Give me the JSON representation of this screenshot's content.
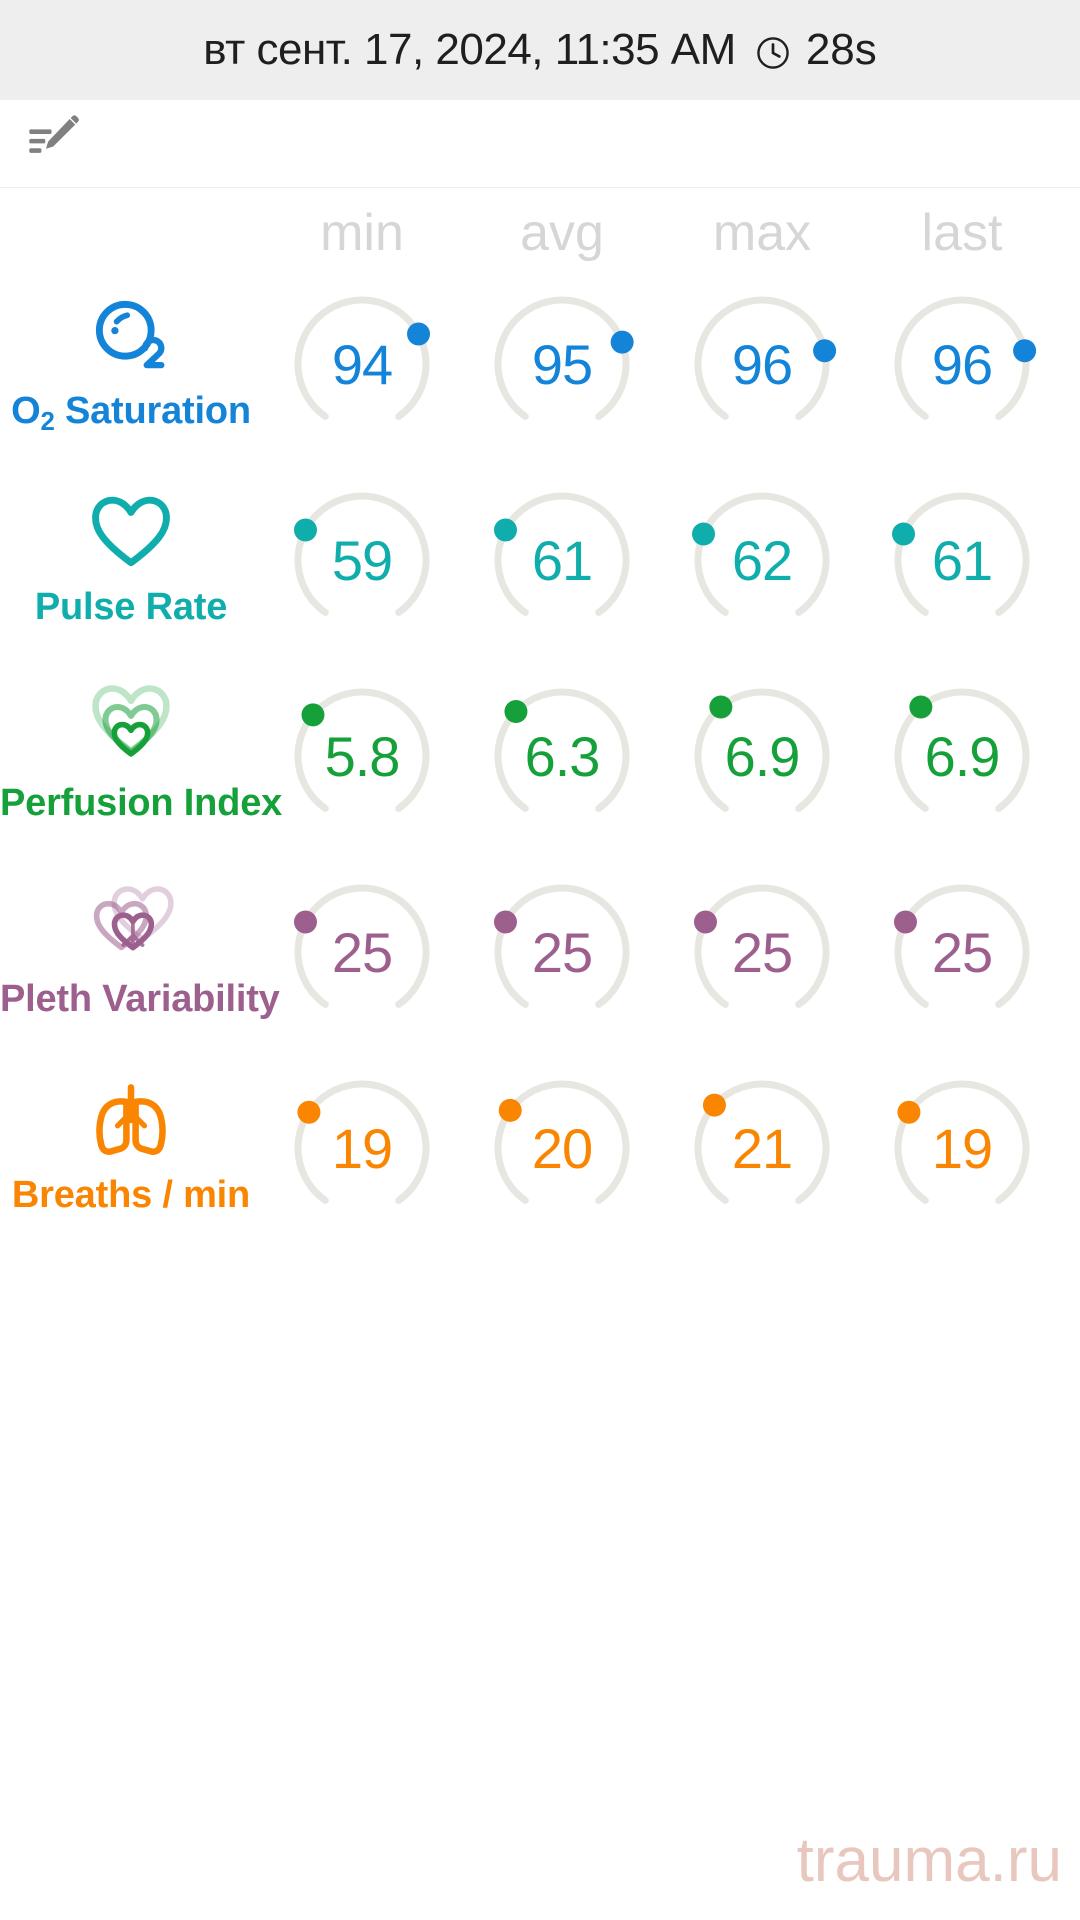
{
  "header": {
    "datetime": "вт сент. 17, 2024, 11:35 AM",
    "clock_icon": "clock-icon",
    "duration": "28s",
    "bg_color": "#eeeeee"
  },
  "toolbar": {
    "edit_note_icon": "edit-note-icon",
    "icon_color": "#808080"
  },
  "table": {
    "columns": [
      "min",
      "avg",
      "max",
      "last"
    ],
    "column_color": "#d6d6d6",
    "track_color": "#e8e6e0"
  },
  "vitals": [
    {
      "label": "O₂ Saturation",
      "label_main": "O",
      "label_sub": "2",
      "label_rest": " Saturation",
      "icon": "oxygen-bubble-icon",
      "color": "#1484d8",
      "values": [
        "94",
        "95",
        "96",
        "96"
      ],
      "marker_angles": [
        62,
        70,
        78,
        78
      ]
    },
    {
      "label": "Pulse Rate",
      "icon": "heart-outline-icon",
      "color": "#0fadac",
      "values": [
        "59",
        "61",
        "62",
        "61"
      ],
      "marker_angles": [
        -62,
        -62,
        -66,
        -66
      ]
    },
    {
      "label": "Perfusion Index",
      "icon": "nested-hearts-icon",
      "color": "#15a03a",
      "values": [
        "5.8",
        "6.3",
        "6.9",
        "6.9"
      ],
      "marker_angles": [
        -50,
        -46,
        -40,
        -40
      ]
    },
    {
      "label": "Pleth Variability",
      "icon": "overlapping-hearts-icon",
      "color": "#9c5f8e",
      "values": [
        "25",
        "25",
        "25",
        "25"
      ],
      "marker_angles": [
        -62,
        -62,
        -62,
        -62
      ]
    },
    {
      "label": "Breaths / min",
      "icon": "lungs-icon",
      "color": "#f98500",
      "values": [
        "19",
        "20",
        "21",
        "19"
      ],
      "marker_angles": [
        -56,
        -54,
        -48,
        -56
      ]
    }
  ],
  "watermark": {
    "text": "trauma.ru",
    "color": "#e8c8be"
  }
}
